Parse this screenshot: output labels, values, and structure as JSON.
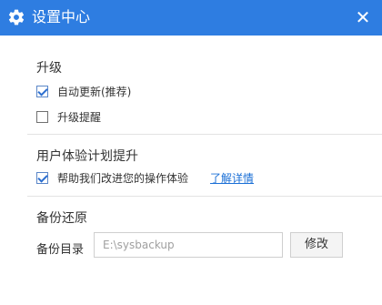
{
  "window": {
    "title": "设置中心",
    "close_label": "✕"
  },
  "upgrade": {
    "title": "升级",
    "auto_update": {
      "label": "自动更新(推荐)",
      "checked": true
    },
    "upgrade_remind": {
      "label": "升级提醒",
      "checked": false
    }
  },
  "ux_plan": {
    "title": "用户体验计划提升",
    "help_improve": {
      "label": "帮助我们改进您的操作体验",
      "checked": true
    },
    "learn_more": "了解详情"
  },
  "backup": {
    "title": "备份还原",
    "dir_label": "备份目录",
    "dir_placeholder": "E:\\sysbackup",
    "modify_label": "修改"
  },
  "colors": {
    "titlebar": "#2e7de1",
    "link": "#1a6fd6"
  },
  "icons": {
    "title": "gear-icon",
    "close": "close-icon"
  }
}
